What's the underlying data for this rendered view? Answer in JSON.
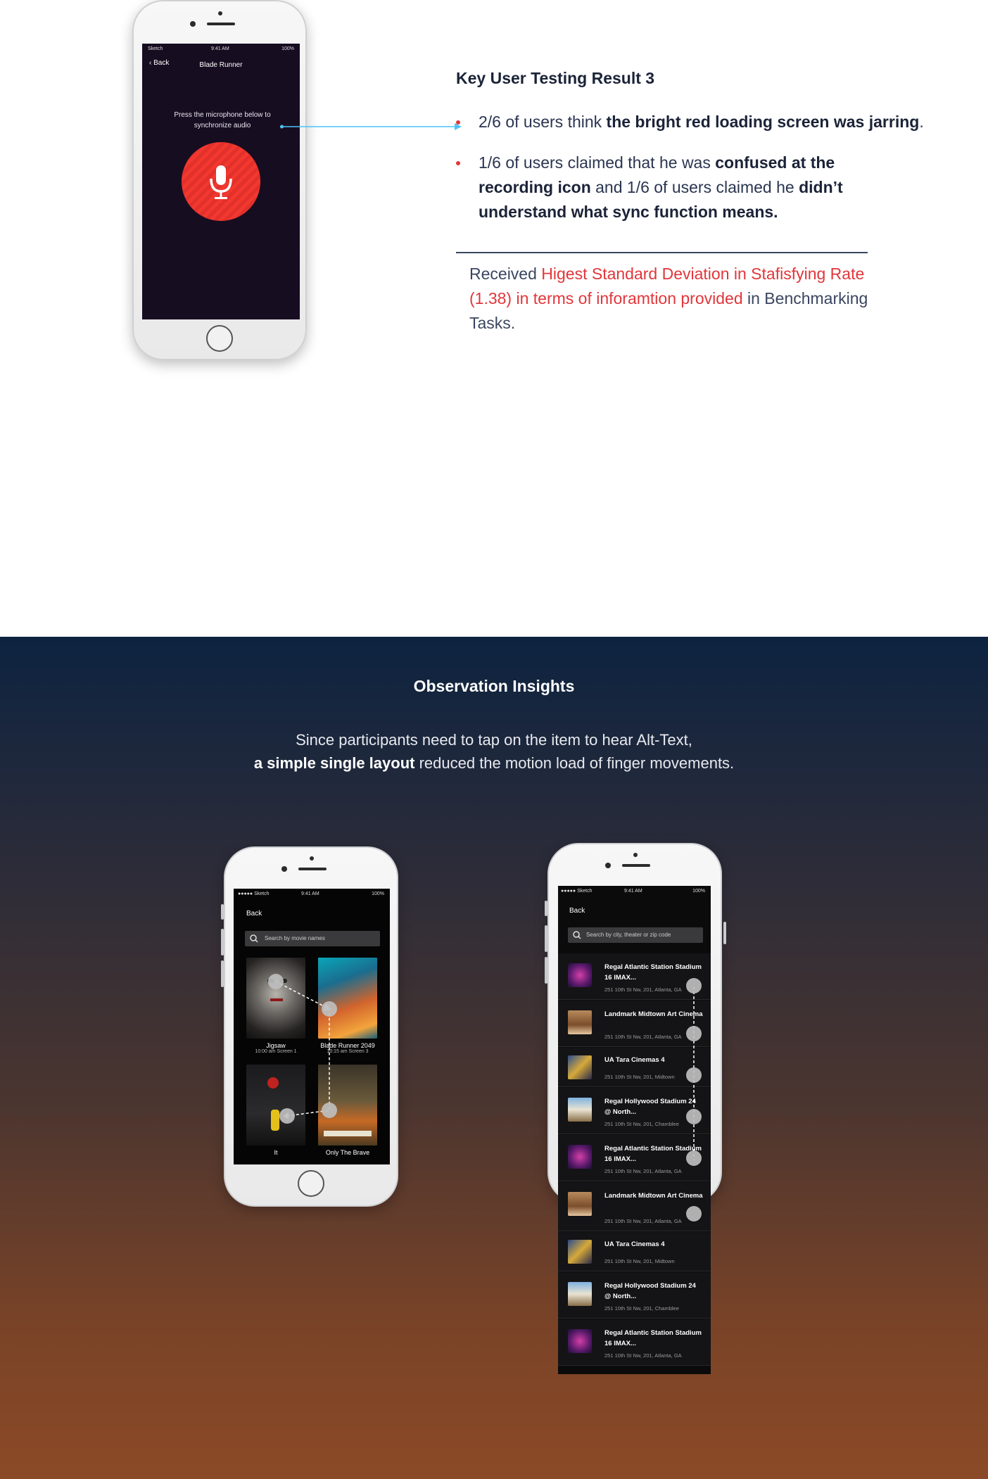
{
  "top_phone": {
    "status": {
      "carrier": "Sketch",
      "time": "9:41 AM",
      "battery": "100%"
    },
    "nav_back": "Back",
    "nav_title": "Blade Runner",
    "instruction": "Press the microphone below to synchronize audio",
    "mic_color": "#f2382f"
  },
  "key_result": {
    "title": "Key User Testing Result 3",
    "bullets": [
      {
        "pre": "2/6 of users think ",
        "bold": "the bright red loading screen was jarring",
        "post": "."
      },
      {
        "pre": "1/6 of users claimed that he was ",
        "bold1": "confused at the recording icon",
        "mid": " and 1/6 of users claimed he ",
        "bold2": "didn’t understand what sync function means."
      }
    ],
    "received_pre": "Received ",
    "received_highlight": "Higest Standard Deviation in Stafisfying Rate (1.38) in terms of inforamtion provided",
    "received_post": " in Benchmarking Tasks."
  },
  "insights": {
    "title": "Observation Insights",
    "line1": "Since participants need to tap on the item to hear Alt-Text,",
    "line2_bold": "a simple single layout",
    "line2_rest": " reduced the motion load of finger movements."
  },
  "movie_phone": {
    "status": {
      "carrier": "●●●●● Sketch",
      "time": "9:41 AM",
      "battery": "100%"
    },
    "back": "Back",
    "search_placeholder": "Search by movie names",
    "movies": [
      {
        "title": "Jigsaw",
        "time": "10:00 am Screen 1"
      },
      {
        "title": "Blade Runner 2049",
        "time": "10:15 am Screen 3"
      },
      {
        "title": "It",
        "time": ""
      },
      {
        "title": "Only The Brave",
        "time": ""
      }
    ]
  },
  "theater_phone": {
    "status": {
      "carrier": "●●●●● Sketch",
      "time": "9:41 AM",
      "battery": "100%"
    },
    "back": "Back",
    "search_placeholder": "Search by city, theater or zip code",
    "theaters": [
      {
        "name": "Regal Atlantic Station Stadium 16 IMAX...",
        "address": "251 10th St Nw, 201, Atlanta, GA"
      },
      {
        "name": "Landmark Midtown Art Cinema",
        "address": "251 10th St Nw, 201, Atlanta, GA"
      },
      {
        "name": "UA Tara Cinemas 4",
        "address": "251 10th St Nw, 201, Midtown"
      },
      {
        "name": "Regal Hollywood Stadium 24 @ North...",
        "address": "251 10th St Nw, 201, Chamblee"
      },
      {
        "name": "Regal Atlantic Station Stadium 16 IMAX...",
        "address": "251 10th St Nw, 201, Atlanta, GA"
      },
      {
        "name": "Landmark Midtown Art Cinema",
        "address": "251 10th St Nw, 201, Atlanta, GA"
      },
      {
        "name": "UA Tara Cinemas 4",
        "address": "251 10th St Nw, 201, Midtown"
      },
      {
        "name": "Regal Hollywood Stadium 24 @ North...",
        "address": "251 10th St Nw, 201, Chamblee"
      },
      {
        "name": "Regal Atlantic Station Stadium 16 IMAX...",
        "address": "251 10th St Nw, 201, Atlanta, GA"
      }
    ]
  },
  "colors": {
    "accent_red": "#e2363a",
    "connector_blue": "#4fc3f7",
    "navy_text": "#1b2338"
  }
}
